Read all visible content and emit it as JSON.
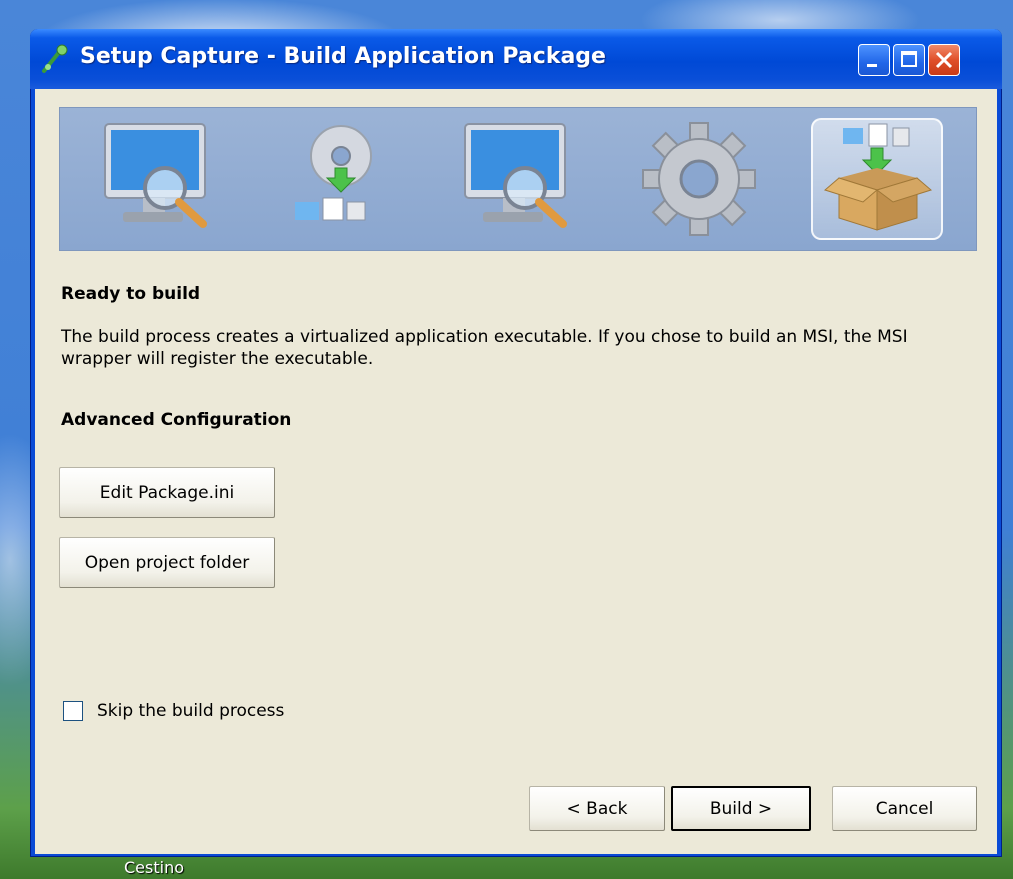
{
  "desktop": {
    "icon_label": "Cestino"
  },
  "window": {
    "title": "Setup Capture - Build Application Package",
    "controls": {
      "minimize": "minimize-icon",
      "maximize": "maximize-icon",
      "close": "close-icon"
    }
  },
  "banner": {
    "steps": [
      {
        "icon": "monitor-search-icon",
        "active": false
      },
      {
        "icon": "disc-install-icon",
        "active": false
      },
      {
        "icon": "monitor-search-icon",
        "active": false
      },
      {
        "icon": "gear-icon",
        "active": false
      },
      {
        "icon": "package-box-icon",
        "active": true
      }
    ]
  },
  "content": {
    "heading": "Ready to build",
    "description": "The build process creates a virtualized application executable. If you chose to build an MSI, the MSI wrapper will register the executable.",
    "advanced_heading": "Advanced Configuration",
    "edit_button": "Edit Package.ini",
    "open_folder_button": "Open project folder",
    "skip_checkbox": {
      "label": "Skip the build process",
      "checked": false
    }
  },
  "footer": {
    "back_label": "< Back",
    "build_label": "Build >",
    "cancel_label": "Cancel"
  }
}
